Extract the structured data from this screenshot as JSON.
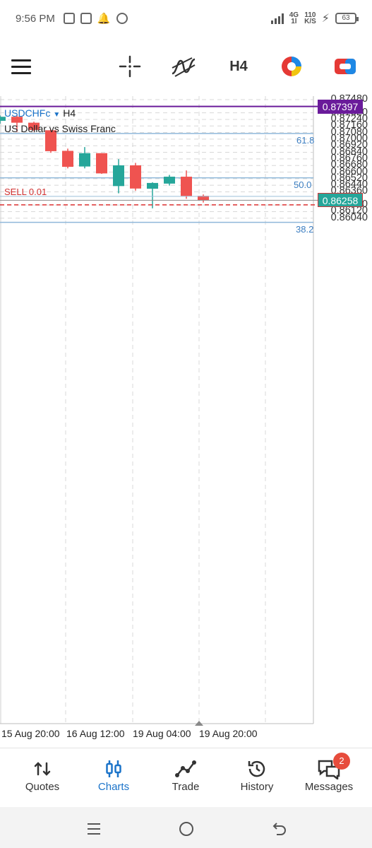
{
  "status_bar": {
    "time": "9:56 PM",
    "net_top": "4G",
    "net_bottom": "1l",
    "speed_top": "110",
    "speed_bottom": "K/S",
    "battery": "63"
  },
  "toolbar": {
    "timeframe": "H4",
    "icons": [
      "menu-icon",
      "crosshair-icon",
      "indicator-icon",
      "timeframe",
      "chart-type-icon",
      "trade-toggle-icon"
    ]
  },
  "chart": {
    "symbol": "USDCHFc",
    "timeframe": "H4",
    "description": "US Dollar vs Swiss Franc",
    "price_labels": [
      "0.87480",
      "0.87320",
      "0.87240",
      "0.87160",
      "0.87080",
      "0.87000",
      "0.86920",
      "0.86840",
      "0.86760",
      "0.86680",
      "0.86600",
      "0.86520",
      "0.86440",
      "0.86360",
      "0.86200",
      "0.86120",
      "0.86040"
    ],
    "upper_badge": "0.87397",
    "current_badge": "0.86258",
    "fib_levels": [
      {
        "label": "61.8",
        "price": 0.87069
      },
      {
        "label": "50.0",
        "price": 0.8653
      },
      {
        "label": "38.2",
        "price": 0.8599
      }
    ],
    "trade_line": {
      "label": "SELL 0.01",
      "price": 0.86262
    },
    "time_labels": [
      "15 Aug 20:00",
      "16 Aug 12:00",
      "19 Aug 04:00",
      "19 Aug 20:00"
    ],
    "colors": {
      "bull": "#26a69a",
      "bear": "#ef5350",
      "fib": "#8fb8da",
      "upper_line": "#6a1b9a",
      "grid": "#d8d8d8"
    }
  },
  "chart_data": {
    "type": "candlestick",
    "ylim": [
      0.8598,
      0.8752
    ],
    "candles": [
      {
        "o": 0.87223,
        "h": 0.87288,
        "l": 0.87188,
        "c": 0.87272
      },
      {
        "o": 0.87272,
        "h": 0.87292,
        "l": 0.87088,
        "c": 0.872
      },
      {
        "o": 0.872,
        "h": 0.87212,
        "l": 0.87096,
        "c": 0.87112
      },
      {
        "o": 0.87108,
        "h": 0.87118,
        "l": 0.86834,
        "c": 0.86854
      },
      {
        "o": 0.86858,
        "h": 0.86885,
        "l": 0.86645,
        "c": 0.86664
      },
      {
        "o": 0.86668,
        "h": 0.86904,
        "l": 0.86645,
        "c": 0.8683
      },
      {
        "o": 0.8683,
        "h": 0.8683,
        "l": 0.86578,
        "c": 0.86584
      },
      {
        "o": 0.8643,
        "h": 0.86757,
        "l": 0.86342,
        "c": 0.86682
      },
      {
        "o": 0.86682,
        "h": 0.86712,
        "l": 0.86374,
        "c": 0.864
      },
      {
        "o": 0.86398,
        "h": 0.86476,
        "l": 0.8616,
        "c": 0.86468
      },
      {
        "o": 0.8646,
        "h": 0.86566,
        "l": 0.86436,
        "c": 0.86544
      },
      {
        "o": 0.86544,
        "h": 0.8662,
        "l": 0.86276,
        "c": 0.8631
      },
      {
        "o": 0.86312,
        "h": 0.86328,
        "l": 0.8623,
        "c": 0.86257
      }
    ]
  },
  "bottom_nav": {
    "items": [
      {
        "id": "quotes",
        "label": "Quotes"
      },
      {
        "id": "charts",
        "label": "Charts"
      },
      {
        "id": "trade",
        "label": "Trade"
      },
      {
        "id": "history",
        "label": "History"
      },
      {
        "id": "messages",
        "label": "Messages"
      }
    ],
    "active": "charts",
    "messages_badge": "2"
  }
}
